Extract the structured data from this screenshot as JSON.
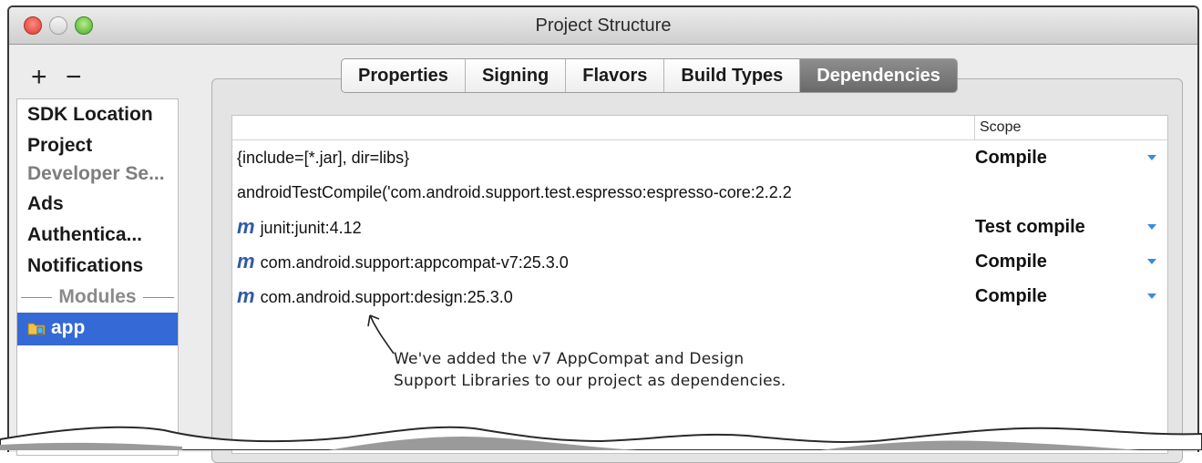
{
  "window": {
    "title": "Project Structure"
  },
  "toolbar": {
    "add_label": "+",
    "remove_label": "−"
  },
  "sidebar": {
    "items": [
      {
        "label": "SDK Location"
      },
      {
        "label": "Project"
      },
      {
        "label": "Developer Se..."
      },
      {
        "label": "Ads"
      },
      {
        "label": "Authentica..."
      },
      {
        "label": "Notifications"
      }
    ],
    "modules_label": "Modules",
    "module": {
      "label": "app"
    }
  },
  "tabs": [
    {
      "label": "Properties"
    },
    {
      "label": "Signing"
    },
    {
      "label": "Flavors"
    },
    {
      "label": "Build Types"
    },
    {
      "label": "Dependencies",
      "active": true
    }
  ],
  "table": {
    "scope_header": "Scope",
    "rows": [
      {
        "name": "{include=[*.jar], dir=libs}",
        "scope": "Compile",
        "maven": false
      },
      {
        "name": "androidTestCompile('com.android.support.test.espresso:espresso-core:2.2.2",
        "scope": "",
        "maven": false
      },
      {
        "name": "junit:junit:4.12",
        "scope": "Test compile",
        "maven": true
      },
      {
        "name": "com.android.support:appcompat-v7:25.3.0",
        "scope": "Compile",
        "maven": true
      },
      {
        "name": "com.android.support:design:25.3.0",
        "scope": "Compile",
        "maven": true
      }
    ],
    "maven_icon": "m"
  },
  "annotation": {
    "line1": "We've added the v7 AppCompat and Design",
    "line2": "Support Libraries to our project as dependencies."
  },
  "colors": {
    "selection": "#3469d6",
    "maven_icon": "#2f5aa8",
    "dropdown_arrow": "#3a8be0"
  }
}
